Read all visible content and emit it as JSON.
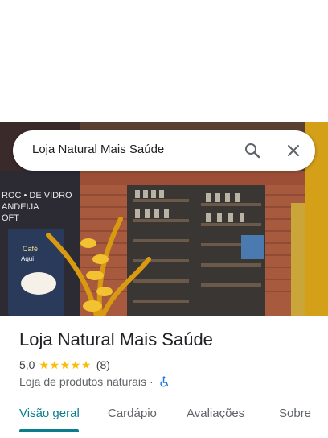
{
  "search": {
    "query": "Loja Natural Mais Saúde",
    "search_icon": "search-icon",
    "close_icon": "close-icon"
  },
  "photo": {
    "description_icon": "storefront-photo",
    "sign_texts": [
      "Café",
      "Aqui"
    ]
  },
  "place": {
    "title": "Loja Natural Mais Saúde",
    "rating": "5,0",
    "stars": "★★★★★",
    "review_count": "(8)",
    "category": "Loja de produtos naturais",
    "separator": "·",
    "accessibility_icon": "wheelchair-icon"
  },
  "tabs": [
    {
      "label": "Visão geral",
      "active": true
    },
    {
      "label": "Cardápio",
      "active": false
    },
    {
      "label": "Avaliações",
      "active": false
    },
    {
      "label": "Sobre",
      "active": false
    }
  ],
  "colors": {
    "accent": "#0b7d8c",
    "star": "#fbbc04"
  }
}
